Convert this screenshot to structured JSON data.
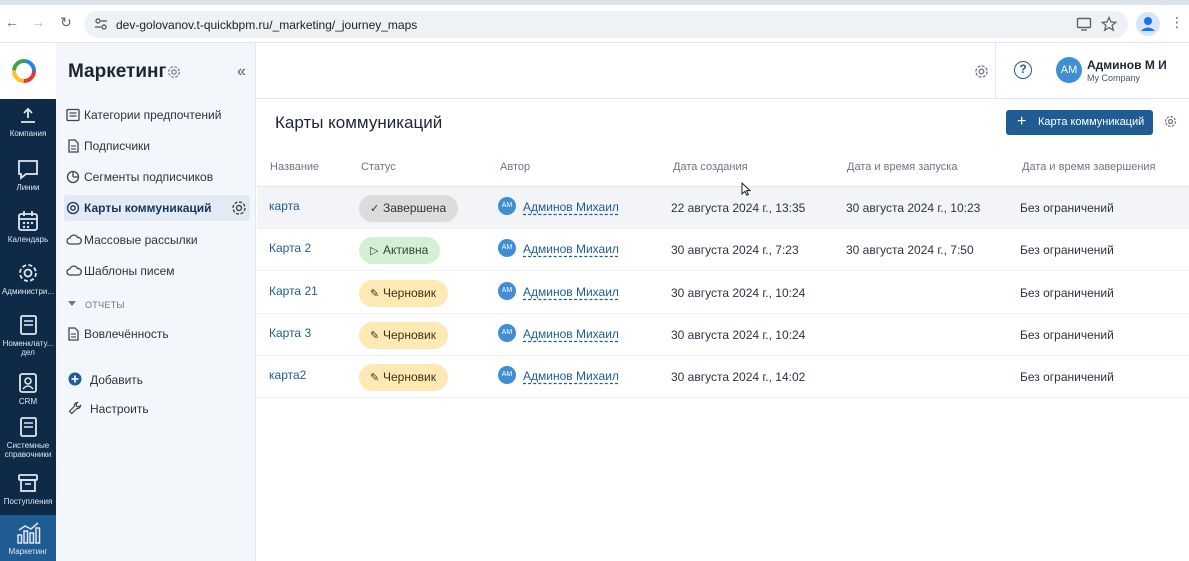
{
  "browser": {
    "url": "dev-golovanov.t-quickbpm.ru/_marketing/_journey_maps"
  },
  "rail": {
    "items": [
      {
        "label": "Компания",
        "icon": "company-icon"
      },
      {
        "label": "Линии",
        "icon": "chat-icon"
      },
      {
        "label": "Календарь",
        "icon": "calendar-icon"
      },
      {
        "label": "Администри...",
        "icon": "gear-icon"
      },
      {
        "label": "Номенклату... дел",
        "icon": "book-icon"
      },
      {
        "label": "CRM",
        "icon": "contact-icon"
      },
      {
        "label": "Системные справочники",
        "icon": "book-icon"
      },
      {
        "label": "Поступления",
        "icon": "inbox-icon"
      },
      {
        "label": "Маркетинг",
        "icon": "analytics-icon"
      }
    ]
  },
  "sidebar": {
    "title": "Маркетинг",
    "items": [
      {
        "label": "Категории предпочтений"
      },
      {
        "label": "Подписчики"
      },
      {
        "label": "Сегменты подписчиков"
      },
      {
        "label": "Карты коммуникаций"
      },
      {
        "label": "Массовые рассылки"
      },
      {
        "label": "Шаблоны писем"
      }
    ],
    "section_reports": "ОТЧЕТЫ",
    "reports": [
      {
        "label": "Вовлечённость"
      }
    ],
    "add_label": "Добавить",
    "configure_label": "Настроить"
  },
  "header": {
    "user_initials": "АМ",
    "user_name": "Админов М И",
    "company": "My Company"
  },
  "main": {
    "title": "Карты коммуникаций",
    "add_button": "Карта коммуникаций",
    "columns": {
      "name": "Название",
      "status": "Статус",
      "author": "Автор",
      "created": "Дата создания",
      "started": "Дата и время запуска",
      "ended": "Дата и время завершения"
    },
    "rows": [
      {
        "name": "карта",
        "status": "Завершена",
        "status_glyph": "✓",
        "author_initials": "АМ",
        "author": "Админов Михаил",
        "created": "22 августа 2024 г., 13:35",
        "started": "30 августа 2024 г., 10:23",
        "ended": "Без ограничений"
      },
      {
        "name": "Карта 2",
        "status": "Активна",
        "status_glyph": "▷",
        "author_initials": "АМ",
        "author": "Админов Михаил",
        "created": "30 августа 2024 г., 7:23",
        "started": "30 августа 2024 г., 7:50",
        "ended": "Без ограничений"
      },
      {
        "name": "Карта 21",
        "status": "Черновик",
        "status_glyph": "✎",
        "author_initials": "АМ",
        "author": "Админов Михаил",
        "created": "30 августа 2024 г., 10:24",
        "started": "",
        "ended": "Без ограничений"
      },
      {
        "name": "Карта 3",
        "status": "Черновик",
        "status_glyph": "✎",
        "author_initials": "АМ",
        "author": "Админов Михаил",
        "created": "30 августа 2024 г., 10:24",
        "started": "",
        "ended": "Без ограничений"
      },
      {
        "name": "карта2",
        "status": "Черновик",
        "status_glyph": "✎",
        "author_initials": "АМ",
        "author": "Админов Михаил",
        "created": "30 августа 2024 г., 14:02",
        "started": "",
        "ended": "Без ограничений"
      }
    ]
  },
  "colors": {
    "rail_bg": "#0e2a47",
    "accent": "#1f5c93",
    "status_done": "#dcdcdc",
    "status_active": "#d5efd5",
    "status_draft": "#fde9b3"
  }
}
